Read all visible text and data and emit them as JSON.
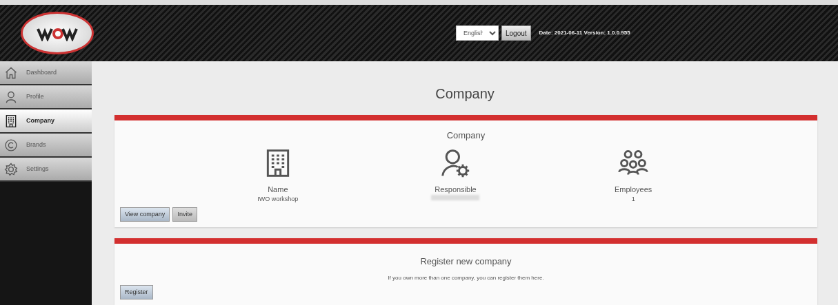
{
  "header": {
    "language": "English",
    "logout": "Logout",
    "date_label": "Date:",
    "date": "2021-06-11",
    "version_label": "Version:",
    "version": "1.0.0.955"
  },
  "sidebar": {
    "items": [
      {
        "label": "Dashboard",
        "selected": false
      },
      {
        "label": "Profile",
        "selected": false
      },
      {
        "label": "Company",
        "selected": true
      },
      {
        "label": "Brands",
        "selected": false
      },
      {
        "label": "Settings",
        "selected": false
      }
    ]
  },
  "page_title": "Company",
  "company_card": {
    "title": "Company",
    "stats": [
      {
        "label": "Name",
        "value": "IWO workshop"
      },
      {
        "label": "Responsible"
      },
      {
        "label": "Employees",
        "value": "1"
      }
    ],
    "buttons": [
      {
        "label": "View company",
        "kind": "primary"
      },
      {
        "label": "Invite",
        "kind": "secondary"
      }
    ]
  },
  "register_card": {
    "title": "Register new company",
    "text": "If you own more than one company, you can register them here.",
    "buttons": [
      {
        "label": "Register",
        "kind": "primary"
      }
    ]
  }
}
